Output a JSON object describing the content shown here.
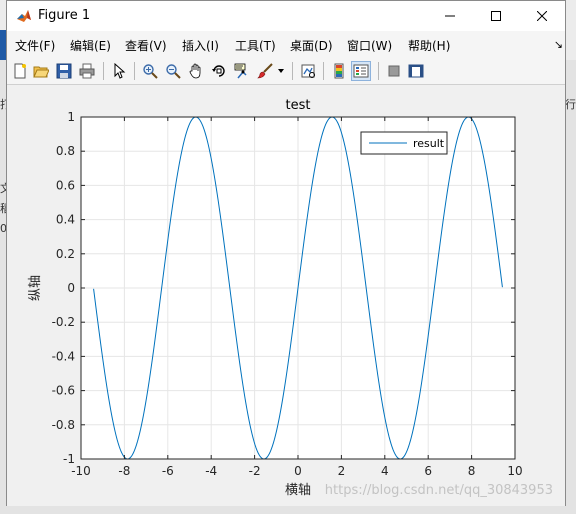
{
  "window": {
    "title": "Figure 1"
  },
  "menu": {
    "items": [
      "文件(F)",
      "编辑(E)",
      "查看(V)",
      "插入(I)",
      "工具(T)",
      "桌面(D)",
      "窗口(W)",
      "帮助(H)"
    ]
  },
  "toolbar": {
    "icons": [
      "new-figure-icon",
      "open-file-icon",
      "save-icon",
      "print-icon",
      "edit-plot-arrow-icon",
      "zoom-in-icon",
      "zoom-out-icon",
      "pan-hand-icon",
      "rotate-3d-icon",
      "data-cursor-icon",
      "brush-icon",
      "link-plot-icon",
      "insert-colorbar-icon",
      "insert-legend-icon",
      "hide-plot-tools-icon",
      "show-plot-tools-icon"
    ]
  },
  "background": {
    "left_glyphs": [
      "打",
      "文",
      "稻",
      "0"
    ],
    "right_glyph": "行"
  },
  "chart_data": {
    "type": "line",
    "title": "test",
    "xlabel": "横轴",
    "ylabel": "纵轴",
    "xlim": [
      -10,
      10
    ],
    "ylim": [
      -1,
      1
    ],
    "xticks": [
      -10,
      -8,
      -6,
      -4,
      -2,
      0,
      2,
      4,
      6,
      8,
      10
    ],
    "yticks": [
      -1,
      -0.8,
      -0.6,
      -0.4,
      -0.2,
      0,
      0.2,
      0.4,
      0.6,
      0.8,
      1
    ],
    "xtick_labels": [
      "-10",
      "-8",
      "-6",
      "-4",
      "-2",
      "0",
      "2",
      "4",
      "6",
      "8",
      "10"
    ],
    "ytick_labels": [
      "-1",
      "-0.8",
      "-0.6",
      "-0.4",
      "-0.2",
      "0",
      "0.2",
      "0.4",
      "0.6",
      "0.8",
      "1"
    ],
    "grid": true,
    "legend_placement": "top-right",
    "series": [
      {
        "name": "result",
        "color": "#0072BD",
        "function": "sin(x)",
        "x_range": [
          -9.42,
          9.42
        ],
        "samples": 400
      }
    ]
  },
  "watermark": "https://blog.csdn.net/qq_30843953"
}
